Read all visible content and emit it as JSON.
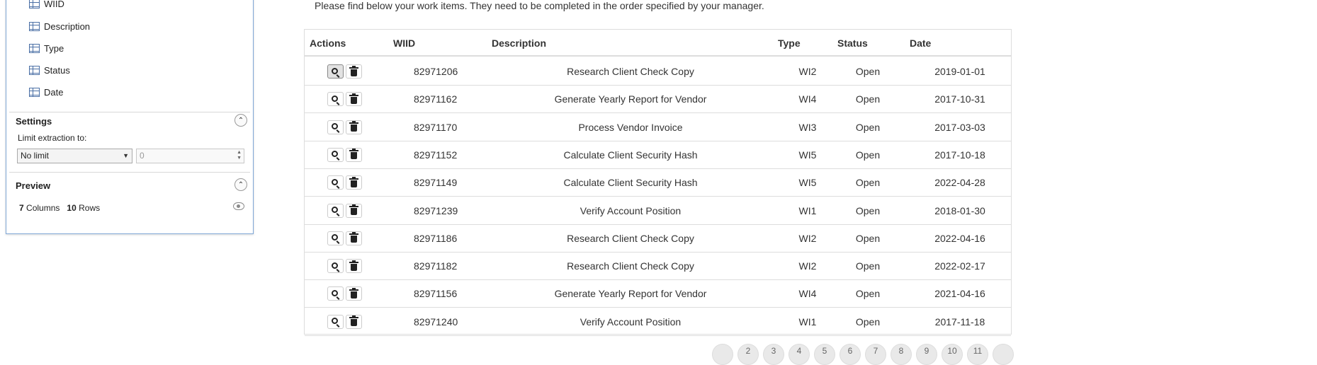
{
  "extraction_panel": {
    "columns": [
      "WIID",
      "Description",
      "Type",
      "Status",
      "Date"
    ],
    "settings": {
      "title": "Settings",
      "limit_label": "Limit extraction to:",
      "limit_select_value": "No limit",
      "limit_number_value": "0"
    },
    "preview": {
      "title": "Preview",
      "columns_count": "7",
      "columns_word": "Columns",
      "rows_count": "10",
      "rows_word": "Rows"
    }
  },
  "intro_text": "Please find below your work items. They need to be completed in the order specified by your manager.",
  "table": {
    "headers": {
      "actions": "Actions",
      "wiid": "WIID",
      "description": "Description",
      "type": "Type",
      "status": "Status",
      "date": "Date"
    },
    "rows": [
      {
        "wiid": "82971206",
        "description": "Research Client Check Copy",
        "type": "WI2",
        "status": "Open",
        "date": "2019-01-01"
      },
      {
        "wiid": "82971162",
        "description": "Generate Yearly Report for Vendor",
        "type": "WI4",
        "status": "Open",
        "date": "2017-10-31"
      },
      {
        "wiid": "82971170",
        "description": "Process Vendor Invoice",
        "type": "WI3",
        "status": "Open",
        "date": "2017-03-03"
      },
      {
        "wiid": "82971152",
        "description": "Calculate Client Security Hash",
        "type": "WI5",
        "status": "Open",
        "date": "2017-10-18"
      },
      {
        "wiid": "82971149",
        "description": "Calculate Client Security Hash",
        "type": "WI5",
        "status": "Open",
        "date": "2022-04-28"
      },
      {
        "wiid": "82971239",
        "description": "Verify Account Position",
        "type": "WI1",
        "status": "Open",
        "date": "2018-01-30"
      },
      {
        "wiid": "82971186",
        "description": "Research Client Check Copy",
        "type": "WI2",
        "status": "Open",
        "date": "2022-04-16"
      },
      {
        "wiid": "82971182",
        "description": "Research Client Check Copy",
        "type": "WI2",
        "status": "Open",
        "date": "2022-02-17"
      },
      {
        "wiid": "82971156",
        "description": "Generate Yearly Report for Vendor",
        "type": "WI4",
        "status": "Open",
        "date": "2021-04-16"
      },
      {
        "wiid": "82971240",
        "description": "Verify Account Position",
        "type": "WI1",
        "status": "Open",
        "date": "2017-11-18"
      }
    ]
  },
  "pagination": [
    "",
    "2",
    "3",
    "4",
    "5",
    "6",
    "7",
    "8",
    "9",
    "10",
    "11",
    ""
  ]
}
